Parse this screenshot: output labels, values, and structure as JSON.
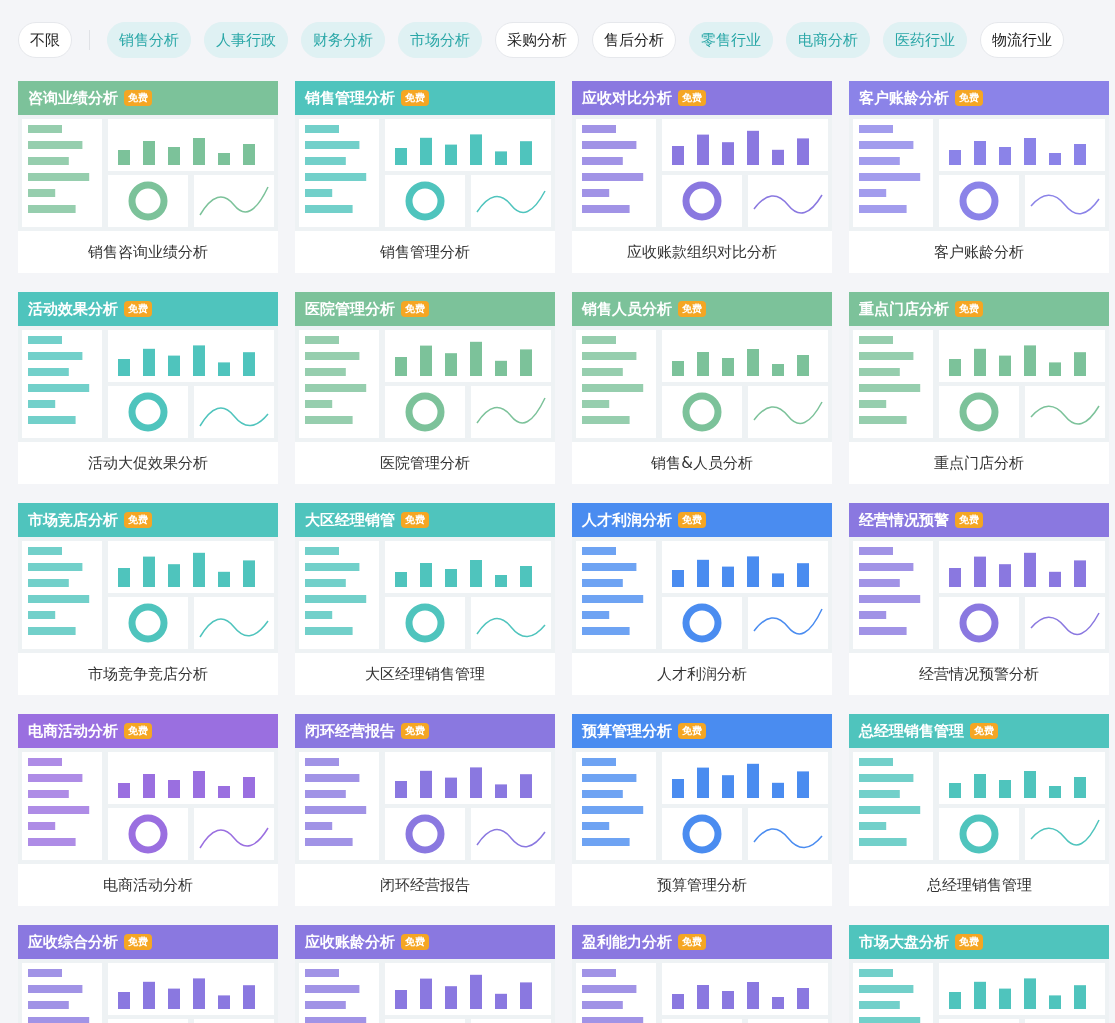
{
  "filters": [
    {
      "label": "不限",
      "selected": false
    },
    {
      "label": "销售分析",
      "selected": true
    },
    {
      "label": "人事行政",
      "selected": true
    },
    {
      "label": "财务分析",
      "selected": true
    },
    {
      "label": "市场分析",
      "selected": true
    },
    {
      "label": "采购分析",
      "selected": false
    },
    {
      "label": "售后分析",
      "selected": false
    },
    {
      "label": "零售行业",
      "selected": true
    },
    {
      "label": "电商分析",
      "selected": true
    },
    {
      "label": "医药行业",
      "selected": true
    },
    {
      "label": "物流行业",
      "selected": false
    }
  ],
  "cards": [
    {
      "title": "咨询业绩分析",
      "badge": "免费",
      "color": "#7cc29a",
      "caption": "销售咨询业绩分析"
    },
    {
      "title": "销售管理分析",
      "badge": "免费",
      "color": "#4fc4bd",
      "caption": "销售管理分析"
    },
    {
      "title": "应收对比分析",
      "badge": "免费",
      "color": "#8a78e0",
      "caption": "应收账款组织对比分析"
    },
    {
      "title": "客户账龄分析",
      "badge": "免费",
      "color": "#8b83e8",
      "caption": "客户账龄分析"
    },
    {
      "title": "活动效果分析",
      "badge": "免费",
      "color": "#4fc4bd",
      "caption": "活动大促效果分析"
    },
    {
      "title": "医院管理分析",
      "badge": "免费",
      "color": "#7cc29a",
      "caption": "医院管理分析"
    },
    {
      "title": "销售人员分析",
      "badge": "免费",
      "color": "#7cc29a",
      "caption": "销售&人员分析"
    },
    {
      "title": "重点门店分析",
      "badge": "免费",
      "color": "#7cc29a",
      "caption": "重点门店分析"
    },
    {
      "title": "市场竞店分析",
      "badge": "免费",
      "color": "#4fc4bd",
      "caption": "市场竞争竞店分析"
    },
    {
      "title": "大区经理销管",
      "badge": "免费",
      "color": "#4fc4bd",
      "caption": "大区经理销售管理"
    },
    {
      "title": "人才利润分析",
      "badge": "免费",
      "color": "#4a8cf0",
      "caption": "人才利润分析"
    },
    {
      "title": "经营情况预警",
      "badge": "免费",
      "color": "#8a78e0",
      "caption": "经营情况预警分析"
    },
    {
      "title": "电商活动分析",
      "badge": "免费",
      "color": "#9a6fe0",
      "caption": "电商活动分析"
    },
    {
      "title": "闭环经营报告",
      "badge": "免费",
      "color": "#8a78e0",
      "caption": "闭环经营报告"
    },
    {
      "title": "预算管理分析",
      "badge": "免费",
      "color": "#4a8cf0",
      "caption": "预算管理分析"
    },
    {
      "title": "总经理销售管理",
      "badge": "免费",
      "color": "#4fc4bd",
      "caption": "总经理销售管理"
    },
    {
      "title": "应收综合分析",
      "badge": "免费",
      "color": "#8a78e0"
    },
    {
      "title": "应收账龄分析",
      "badge": "免费",
      "color": "#8a78e0"
    },
    {
      "title": "盈利能力分析",
      "badge": "免费",
      "color": "#8a78e0"
    },
    {
      "title": "市场大盘分析",
      "badge": "免费",
      "color": "#4fc4bd"
    }
  ]
}
